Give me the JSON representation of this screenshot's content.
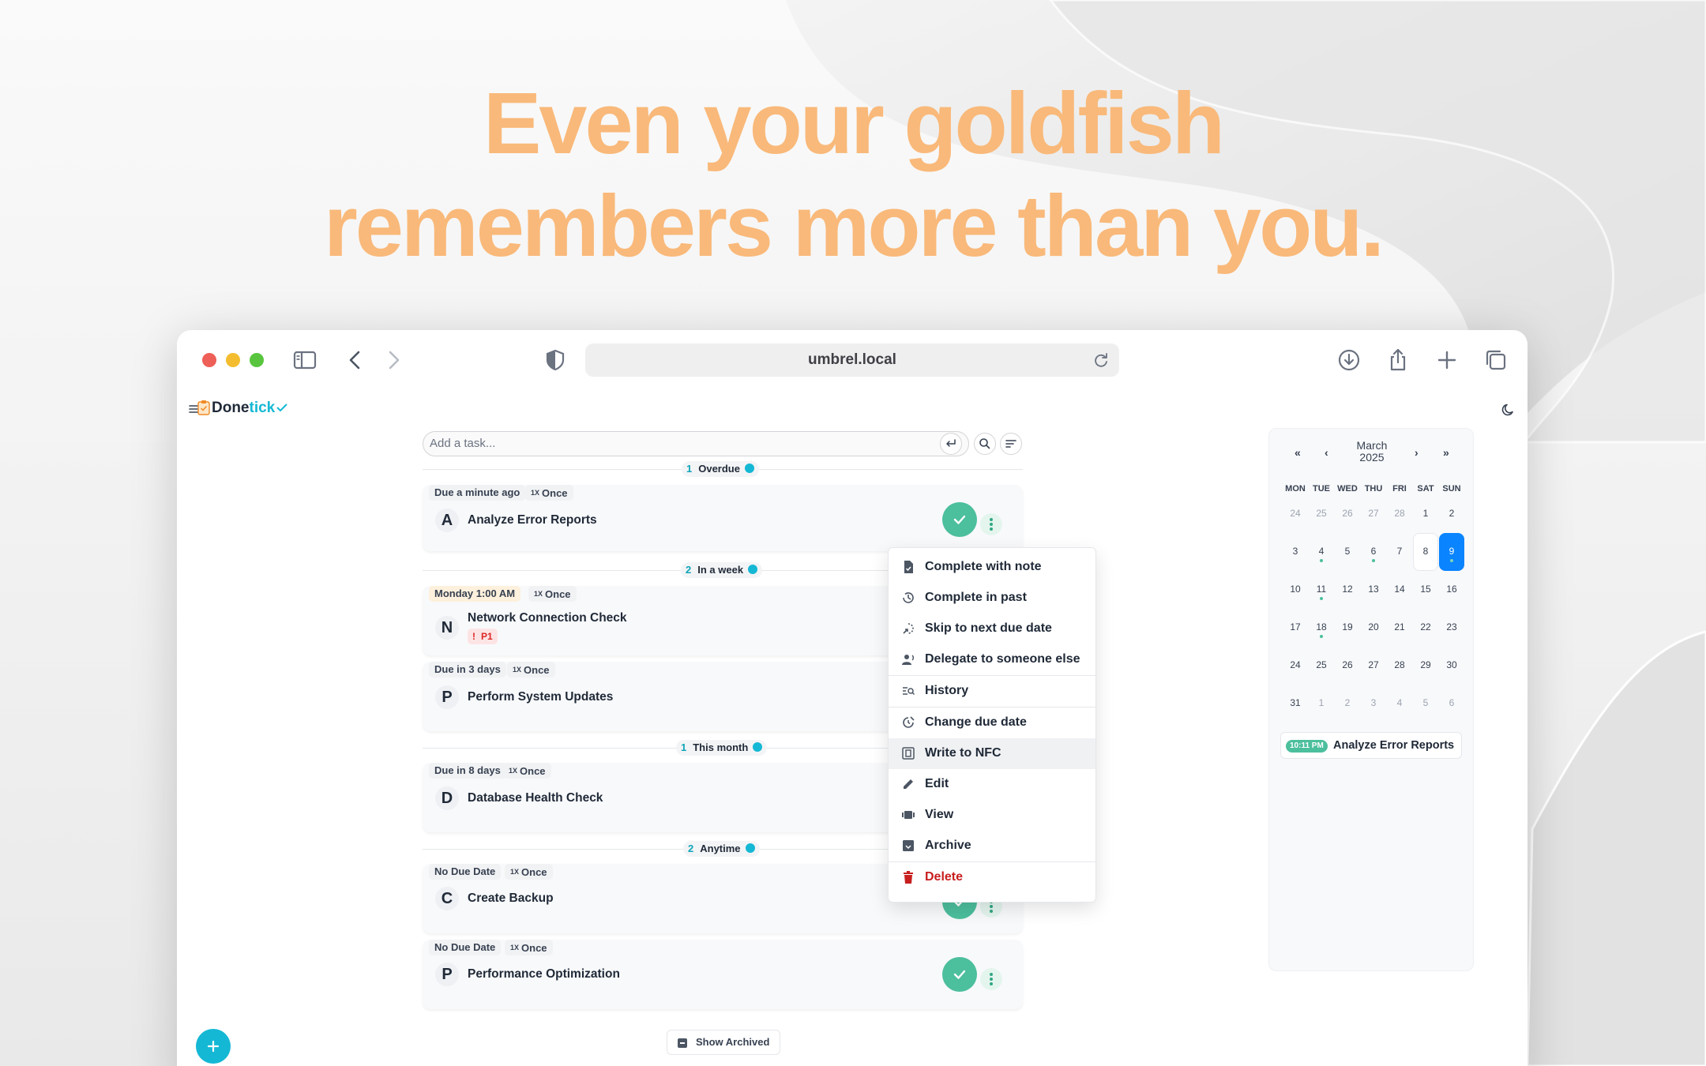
{
  "hero": {
    "line1": "Even your goldfish",
    "line2": "remembers more than you."
  },
  "browser": {
    "url": "umbrel.local"
  },
  "app": {
    "brand_part1": "Done",
    "brand_part2": "tick",
    "add_task_placeholder": "Add a task...",
    "show_archived": "Show Archived"
  },
  "groups": [
    {
      "count": "1",
      "label": "Overdue"
    },
    {
      "count": "2",
      "label": "In a week"
    },
    {
      "count": "1",
      "label": "This month"
    },
    {
      "count": "2",
      "label": "Anytime"
    }
  ],
  "tasks": [
    {
      "due": "Due a minute ago",
      "repeat_x": "1X",
      "repeat": "Once",
      "initial": "A",
      "title": "Analyze Error Reports"
    },
    {
      "due": "Monday 1:00 AM",
      "repeat_x": "1X",
      "repeat": "Once",
      "initial": "N",
      "title": "Network Connection Check",
      "priority": "P1",
      "priority_mark": "!"
    },
    {
      "due": "Due in 3 days",
      "repeat_x": "1X",
      "repeat": "Once",
      "initial": "P",
      "title": "Perform System Updates"
    },
    {
      "due": "Due in 8 days",
      "repeat_x": "1X",
      "repeat": "Once",
      "initial": "D",
      "title": "Database Health Check"
    },
    {
      "due": "No Due Date",
      "repeat_x": "1X",
      "repeat": "Once",
      "initial": "C",
      "title": "Create Backup"
    },
    {
      "due": "No Due Date",
      "repeat_x": "1X",
      "repeat": "Once",
      "initial": "P",
      "title": "Performance Optimization"
    }
  ],
  "context_menu": {
    "items": [
      {
        "label": "Complete with note",
        "icon": "note-check-icon"
      },
      {
        "label": "Complete in past",
        "icon": "history-clock-icon"
      },
      {
        "label": "Skip to next due date",
        "icon": "skip-icon"
      },
      {
        "label": "Delegate to someone else",
        "icon": "delegate-icon"
      },
      {
        "label": "History",
        "icon": "history-list-icon"
      },
      {
        "label": "Change due date",
        "icon": "clock-edit-icon"
      },
      {
        "label": "Write to NFC",
        "icon": "nfc-icon"
      },
      {
        "label": "Edit",
        "icon": "pencil-icon"
      },
      {
        "label": "View",
        "icon": "view-icon"
      },
      {
        "label": "Archive",
        "icon": "archive-icon"
      },
      {
        "label": "Delete",
        "icon": "trash-icon"
      }
    ],
    "highlighted": "Write to NFC"
  },
  "calendar": {
    "month": "March",
    "year": "2025",
    "nav": {
      "prev_year": "«",
      "prev_month": "‹",
      "next_month": "›",
      "next_year": "»"
    },
    "weekdays": [
      "MON",
      "TUE",
      "WED",
      "THU",
      "FRI",
      "SAT",
      "SUN"
    ],
    "weeks": [
      [
        "24",
        "25",
        "26",
        "27",
        "28",
        "1",
        "2"
      ],
      [
        "3",
        "4",
        "5",
        "6",
        "7",
        "8",
        "9"
      ],
      [
        "10",
        "11",
        "12",
        "13",
        "14",
        "15",
        "16"
      ],
      [
        "17",
        "18",
        "19",
        "20",
        "21",
        "22",
        "23"
      ],
      [
        "24",
        "25",
        "26",
        "27",
        "28",
        "29",
        "30"
      ],
      [
        "31",
        "1",
        "2",
        "3",
        "4",
        "5",
        "6"
      ]
    ],
    "today": "8",
    "selected": "9",
    "event": {
      "time": "10:11 PM",
      "title": "Analyze Error Reports"
    }
  },
  "colors": {
    "accent": "#14b8d4",
    "complete": "#4cbf9d",
    "headline": "#f9b97a",
    "selected_day": "#0a84ff",
    "delete": "#c81e1e"
  }
}
